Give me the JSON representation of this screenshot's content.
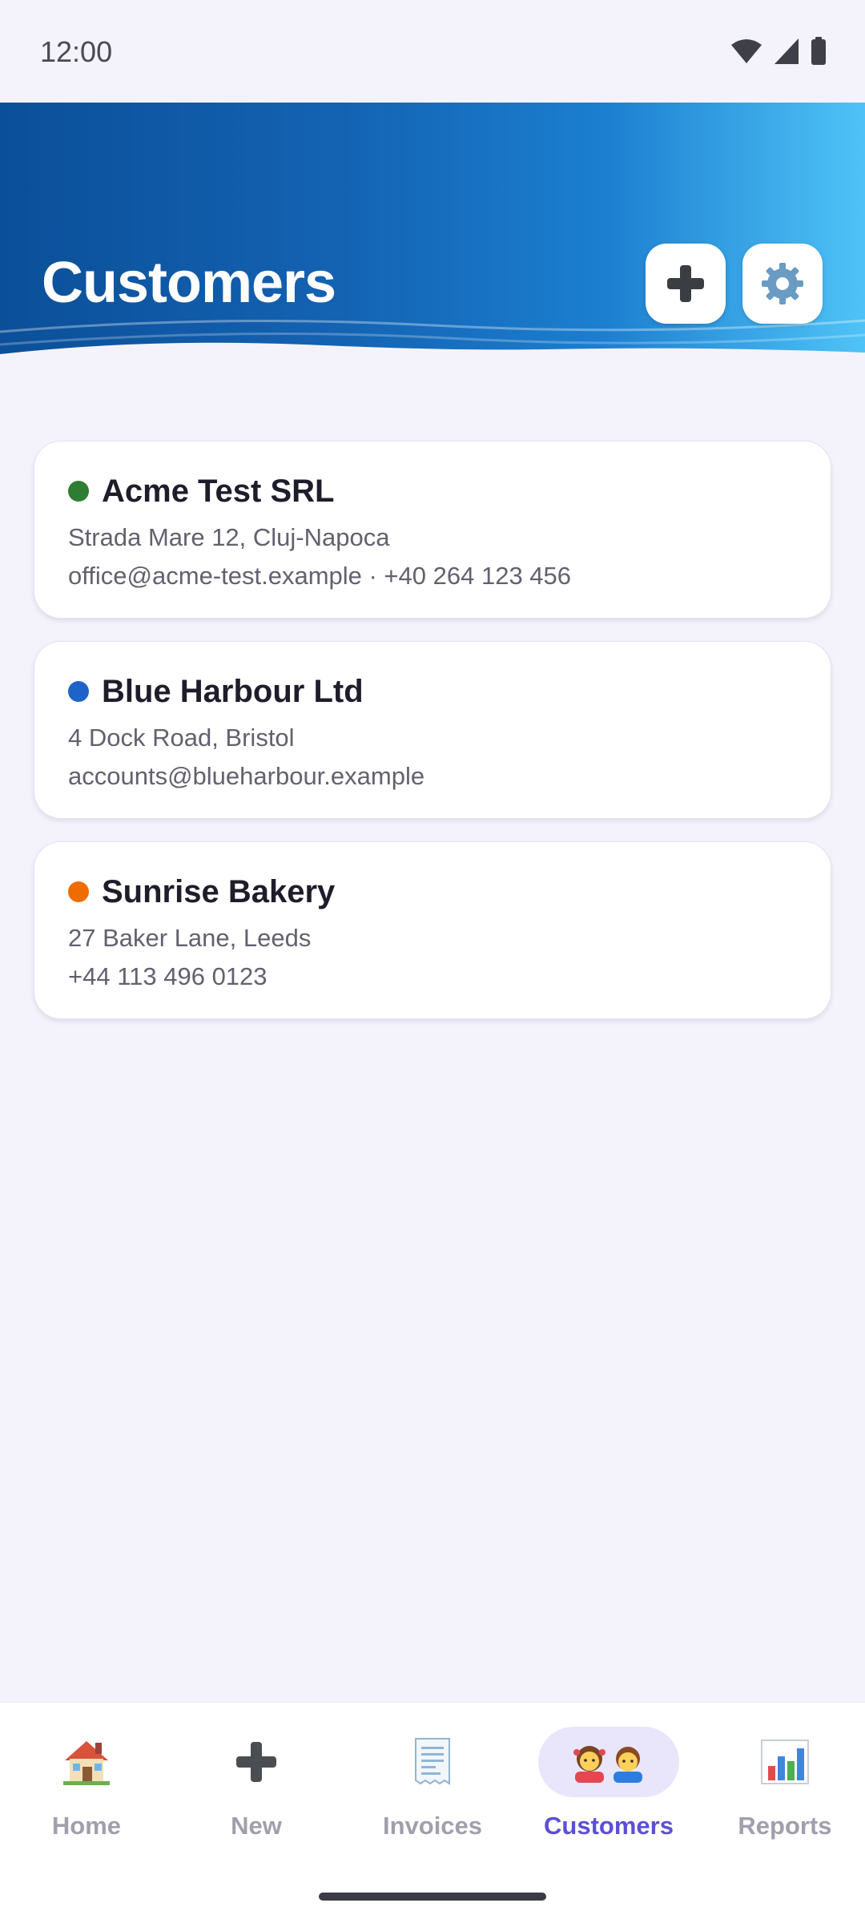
{
  "status_bar": {
    "time": "12:00"
  },
  "header": {
    "title": "Customers",
    "add_icon": "plus-icon",
    "settings_icon": "gear-icon"
  },
  "customers": [
    {
      "name": "Acme Test SRL",
      "address": "Strada Mare 12, Cluj-Napoca",
      "contact": "office@acme-test.example · +40 264 123 456",
      "dot_color": "#2e7d32"
    },
    {
      "name": "Blue Harbour Ltd",
      "address": "4 Dock Road, Bristol",
      "contact": "accounts@blueharbour.example",
      "dot_color": "#1e64c8"
    },
    {
      "name": "Sunrise Bakery",
      "address": "27 Baker Lane, Leeds",
      "contact": "+44 113 496 0123",
      "dot_color": "#ef6c00"
    }
  ],
  "bottom_nav": {
    "active": "Customers",
    "items": [
      {
        "label": "Home",
        "icon": "house-icon"
      },
      {
        "label": "New",
        "icon": "plus-icon"
      },
      {
        "label": "Invoices",
        "icon": "receipt-icon"
      },
      {
        "label": "Customers",
        "icon": "people-icon"
      },
      {
        "label": "Reports",
        "icon": "bar-chart-icon"
      }
    ]
  },
  "colors": {
    "accent": "#5b4fd6",
    "header_start": "#0b4f99",
    "header_end": "#4fc3f7",
    "background": "#f4f3fc"
  }
}
